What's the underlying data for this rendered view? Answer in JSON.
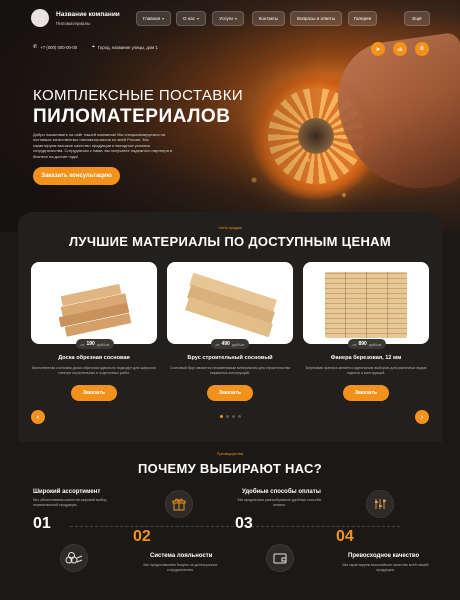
{
  "header": {
    "brand_name": "Название компании",
    "brand_sub": "Пиломатериалы",
    "nav": [
      {
        "label": "Главная",
        "has_chevron": true
      },
      {
        "label": "О нас",
        "has_chevron": true
      },
      {
        "label": "Услуги",
        "has_chevron": true
      },
      {
        "label": "Контакты",
        "has_chevron": false
      },
      {
        "label": "Вопросы и ответы",
        "has_chevron": false
      },
      {
        "label": "Галерея",
        "has_chevron": false
      },
      {
        "label": "Ещё",
        "has_chevron": false
      }
    ],
    "phone": "+7 (000) 000-00-00",
    "address": "Город, название улицы, дом 1",
    "social_icons": [
      "telegram-icon",
      "vk-icon",
      "odnoklassniki-icon"
    ]
  },
  "hero": {
    "title_line1": "КОМПЛЕКСНЫЕ ПОСТАВКИ",
    "title_line2": "ПИЛОМАТЕРИАЛОВ",
    "text": "Добро пожаловать на сайт нашей компании! Мы специализируемся на поставках качественных пиломатериалов по всей России. Мы гарантируем высокое качество продукции и выгодные условия сотрудничества. Сотрудничая с нами, вы получаете надежного партнера в бизнесе на долгие годы!",
    "cta": "Заказать консультацию"
  },
  "products": {
    "eyebrow": "Хиты продаж",
    "title": "ЛУЧШИЕ МАТЕРИАЛЫ ПО ДОСТУПНЫМ ЦЕНАМ",
    "items": [
      {
        "price_prefix": "от",
        "price": "190",
        "price_unit": "руб/шт",
        "name": "Доска обрезная сосновая",
        "desc": "Качественная сосновая доска обрезная идеально подходит для широкого спектра строительных и отделочных работ.",
        "button": "Заказать"
      },
      {
        "price_prefix": "от",
        "price": "490",
        "price_unit": "руб/шт",
        "name": "Брус строительный сосновый",
        "desc": "Сосновый брус является незаменимым материалом для строительства каркасных конструкций.",
        "button": "Заказать"
      },
      {
        "price_prefix": "от",
        "price": "890",
        "price_unit": "руб/шт",
        "name": "Фанера березовая, 12 мм",
        "desc": "Березовая фанера является идеальным выбором для различных видов отделки и конструкций.",
        "button": "Заказать"
      }
    ],
    "prev_icon": "chevron-left-icon",
    "next_icon": "chevron-right-icon",
    "pagination_total": 4,
    "pagination_active": 1
  },
  "why": {
    "eyebrow": "Преимущества",
    "title": "ПОЧЕМУ ВЫБИРАЮТ НАС?",
    "features": [
      {
        "num": "01",
        "title": "Широкий ассортимент",
        "desc": "Мы обеспечиваем клиентов широкий выбор первоклассной продукции.",
        "icon": "logs-icon"
      },
      {
        "num": "02",
        "title": "Система лояльности",
        "desc": "Мы предоставляем бонусы за долгосрочное сотрудничество.",
        "icon": "gift-icon"
      },
      {
        "num": "03",
        "title": "Удобные способы оплаты",
        "desc": "Мы предлагаем разнообразные удобные способы оплаты.",
        "icon": "wallet-icon"
      },
      {
        "num": "04",
        "title": "Превосходное качество",
        "desc": "Мы гарантируем высочайшее качество всей нашей продукции.",
        "icon": "quality-icon"
      }
    ]
  },
  "colors": {
    "accent": "#f2921d",
    "bg_dark": "#1b1816",
    "card_bg": "#221f1d"
  }
}
